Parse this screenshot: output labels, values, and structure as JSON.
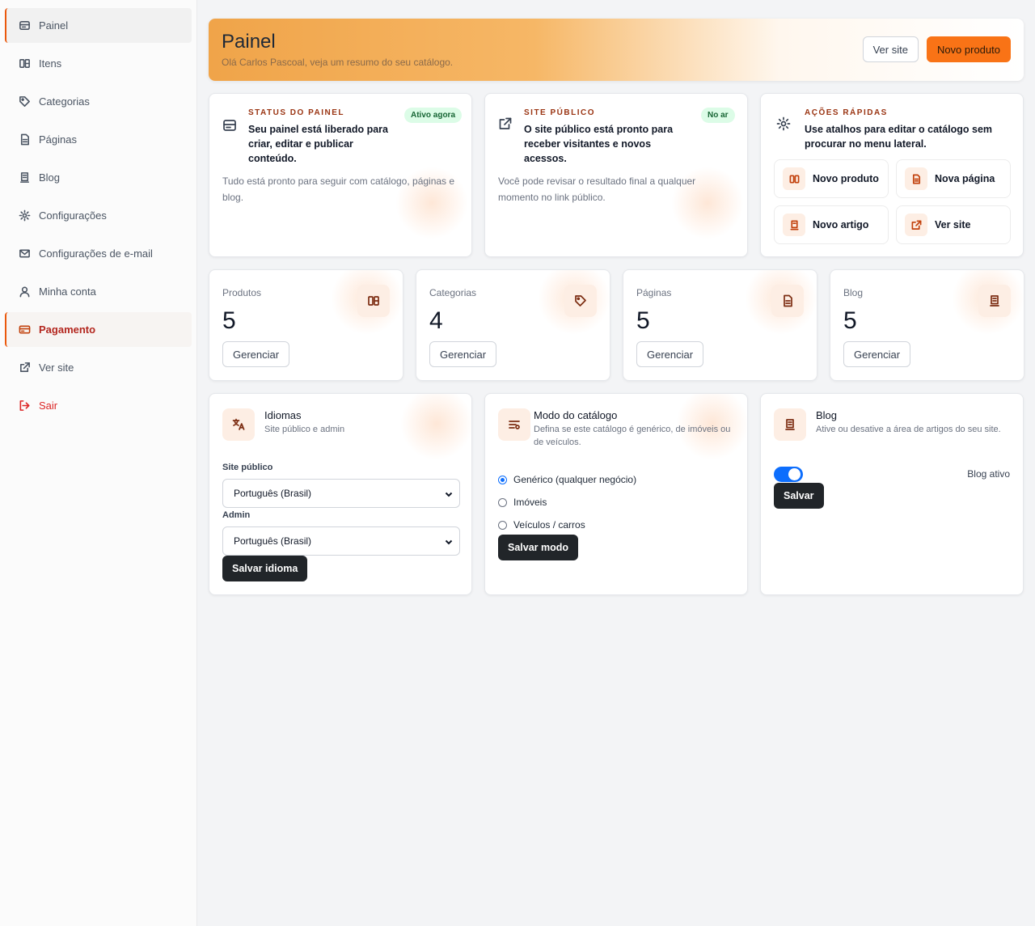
{
  "sidebar": {
    "items": [
      {
        "label": "Painel",
        "icon": "dashboard-icon"
      },
      {
        "label": "Itens",
        "icon": "items-icon"
      },
      {
        "label": "Categorias",
        "icon": "tag-icon"
      },
      {
        "label": "Páginas",
        "icon": "page-icon"
      },
      {
        "label": "Blog",
        "icon": "blog-icon"
      },
      {
        "label": "Configurações",
        "icon": "gear-icon"
      },
      {
        "label": "Configurações de e-mail",
        "icon": "mail-icon"
      },
      {
        "label": "Minha conta",
        "icon": "user-icon"
      },
      {
        "label": "Pagamento",
        "icon": "card-icon"
      },
      {
        "label": "Ver site",
        "icon": "external-link-icon"
      },
      {
        "label": "Sair",
        "icon": "logout-icon"
      }
    ]
  },
  "header": {
    "title": "Painel",
    "subtitle": "Olá Carlos Pascoal, veja um resumo do seu catálogo.",
    "view_site": "Ver site",
    "new_product": "Novo produto"
  },
  "status": {
    "eyebrow": "STATUS DO PAINEL",
    "badge": "Ativo agora",
    "headline": "Seu painel está liberado para criar, editar e publicar conteúdo.",
    "desc": "Tudo está pronto para seguir com catálogo, páginas e blog."
  },
  "public_site": {
    "eyebrow": "SITE PÚBLICO",
    "badge": "No ar",
    "headline": "O site público está pronto para receber visitantes e novos acessos.",
    "desc": "Você pode revisar o resultado final a qualquer momento no link público."
  },
  "quick_actions": {
    "eyebrow": "AÇÕES RÁPIDAS",
    "headline": "Use atalhos para editar o catálogo sem procurar no menu lateral.",
    "buttons": [
      "Novo produto",
      "Nova página",
      "Novo artigo",
      "Ver site"
    ]
  },
  "stats": [
    {
      "label": "Produtos",
      "value": "5",
      "action": "Gerenciar"
    },
    {
      "label": "Categorias",
      "value": "4",
      "action": "Gerenciar"
    },
    {
      "label": "Páginas",
      "value": "5",
      "action": "Gerenciar"
    },
    {
      "label": "Blog",
      "value": "5",
      "action": "Gerenciar"
    }
  ],
  "languages": {
    "title": "Idiomas",
    "subtitle": "Site público e admin",
    "public_label": "Site público",
    "public_value": "Português (Brasil)",
    "admin_label": "Admin",
    "admin_value": "Português (Brasil)",
    "save": "Salvar idioma"
  },
  "catalog_mode": {
    "title": "Modo do catálogo",
    "subtitle": "Defina se este catálogo é genérico, de imóveis ou de veículos.",
    "options": [
      "Genérico (qualquer negócio)",
      "Imóveis",
      "Veículos / carros"
    ],
    "selected": 0,
    "save": "Salvar modo"
  },
  "blog_settings": {
    "title": "Blog",
    "subtitle": "Ative ou desative a área de artigos do seu site.",
    "toggle_label": "Blog ativo",
    "toggle_on": true,
    "save": "Salvar"
  },
  "colors": {
    "accent": "#f97316",
    "active_text": "#b3261e",
    "badge_bg": "#dcfce7",
    "dark_button": "#212529"
  }
}
